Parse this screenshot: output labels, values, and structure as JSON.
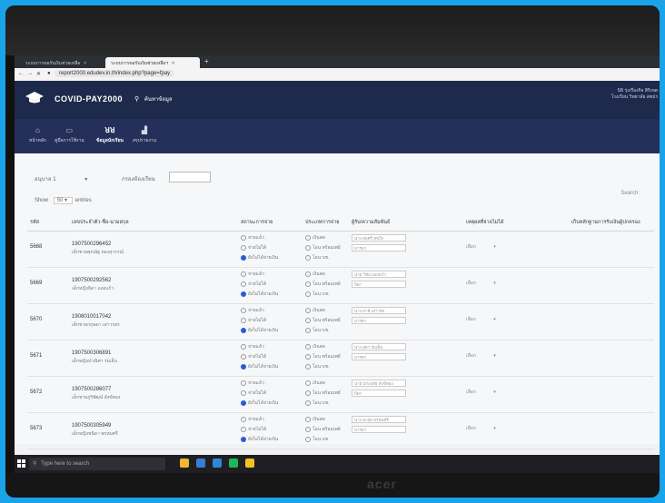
{
  "browser": {
    "tabs": [
      {
        "label": "ระบบการขอรับเงินช่วยเหลือ",
        "active": false
      },
      {
        "label": "ระบบการขอรับเงินช่วยเหลือฯ",
        "active": true
      }
    ],
    "new_tab": "+",
    "url": "report2000.edudev.in.th/index.php?page=fpay"
  },
  "app": {
    "title": "COVID-PAY2000",
    "search_label": "ค้นหาข้อมูล",
    "user": {
      "line1": "นิธิ รุ่งเรืองกิจ สิริเขต",
      "line2": "โรงเรียน วิทยาลัย สพปร"
    }
  },
  "nav": [
    {
      "icon": "home-icon",
      "glyph": "⌂",
      "label": "หน้าหลัก",
      "active": false
    },
    {
      "icon": "monitor-icon",
      "glyph": "▭",
      "label": "คู่มือการใช้งาน",
      "active": false
    },
    {
      "icon": "users-icon",
      "glyph": "ꓤꓤ",
      "label": "ข้อมูลนักเรียน",
      "active": true
    },
    {
      "icon": "chart-icon",
      "glyph": "▟",
      "label": "สรุปรายงาน",
      "active": false
    }
  ],
  "filters": {
    "class_label": "อนุบาล 1",
    "room_label": "กรองห้องเรียน",
    "show_label": "Show",
    "show_value": "50",
    "entries_label": "entries",
    "search_label": "Search:"
  },
  "table": {
    "headers": [
      "รหัส",
      "เลขประจำตัว-ชื่อ-นามสกุล",
      "สถานะการจ่าย",
      "ประเภทการจ่าย",
      "ผู้รับ/ความสัมพันธ์",
      "เหตุผลที่จ่ายไม่ได้",
      "เก็บหลักฐานการรับเงินผู้ปกครอง"
    ],
    "pay_status": [
      "จ่ายแล้ว",
      "จ่ายไม่ได้",
      "ยังไม่ได้จ่ายเงิน"
    ],
    "pay_type": [
      "เงินสด",
      "โอน พร้อมเพย์",
      "โอน บช."
    ],
    "select_label": "เลือก",
    "rows": [
      {
        "id": "5668",
        "student_id": "1907500296452",
        "name": "เด็กชายศุภณัฐ ทองสุวรรณ์",
        "receiver": "นาง สมศรี สุขใจ",
        "relation": "มารดา",
        "status": 2
      },
      {
        "id": "5669",
        "student_id": "1907500292562",
        "name": "เด็กหญิงธิดา แสงแก้ว",
        "receiver": "นาย วิชัย แสงแก้ว",
        "relation": "บิดา",
        "status": 2
      },
      {
        "id": "5670",
        "student_id": "1908010017042",
        "name": "เด็กชายกฤษดา เสาวรสร",
        "receiver": "นาง มาลี เสาวรส",
        "relation": "มารดา",
        "status": 2
      },
      {
        "id": "5671",
        "student_id": "1907500306891",
        "name": "เด็กหญิงปาณิศา ร่มเย็น",
        "receiver": "นาง สุดา ร่มเย็น",
        "relation": "มารดา",
        "status": 2
      },
      {
        "id": "5672",
        "student_id": "1907500286077",
        "name": "เด็กชายภูริพัฒน์ สังข์ทอง",
        "receiver": "นาย ประยุทธ สังข์ทอง",
        "relation": "บิดา",
        "status": 2
      },
      {
        "id": "5673",
        "student_id": "1907500305949",
        "name": "เด็กหญิงชนิดา พรหมศรี",
        "receiver": "นาง ละมัย พรหมศรี",
        "relation": "มารดา",
        "status": 2
      }
    ]
  },
  "taskbar": {
    "search_placeholder": "Type here to search",
    "apps": [
      {
        "name": "file-explorer-icon",
        "color": "#f2b632"
      },
      {
        "name": "store-icon",
        "color": "#3b7bd6"
      },
      {
        "name": "mail-icon",
        "color": "#2b88d8"
      },
      {
        "name": "spotify-icon",
        "color": "#1db954"
      },
      {
        "name": "chrome-icon",
        "color": "#f0c420"
      }
    ]
  },
  "monitor_brand": "acer",
  "colors": {
    "appbar": "#1d2a4b",
    "navbar": "#24305a",
    "accent": "#2a5bd7",
    "frame": "#1aa3e8"
  }
}
